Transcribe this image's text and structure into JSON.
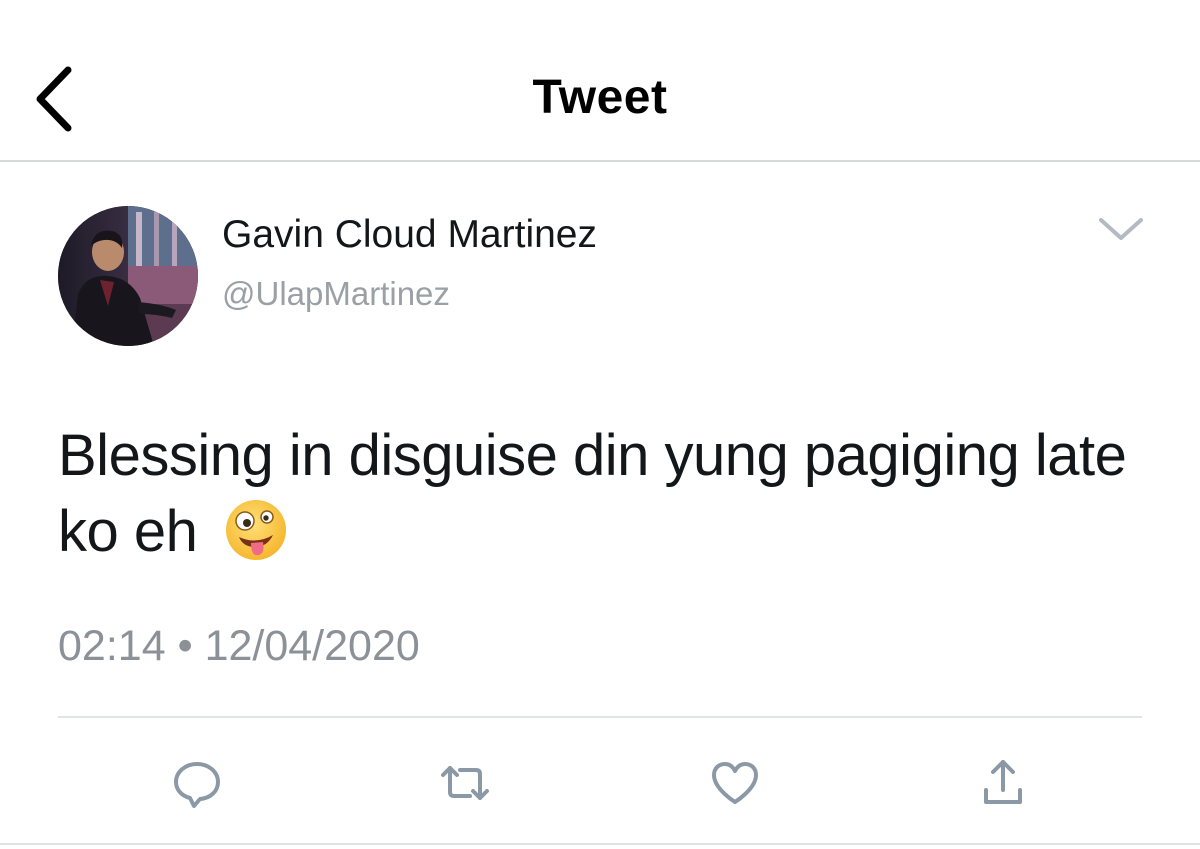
{
  "header": {
    "title": "Tweet",
    "back_icon": "chevron-left-icon"
  },
  "tweet": {
    "author_name": "Gavin Cloud Martinez",
    "author_handle": "@UlapMartinez",
    "text": "Blessing in disguise din yung pagiging late ko eh",
    "emoji": "zany-face-emoji",
    "time": "02:14",
    "separator": "•",
    "date": "12/04/2020"
  },
  "actions": [
    {
      "name": "reply",
      "icon": "reply-icon"
    },
    {
      "name": "retweet",
      "icon": "retweet-icon"
    },
    {
      "name": "like",
      "icon": "heart-icon"
    },
    {
      "name": "share",
      "icon": "share-icon"
    }
  ],
  "colors": {
    "text_primary": "#14171a",
    "text_secondary": "#8b9197",
    "icon_gray": "#8b98a5",
    "divider": "#e1e4e7"
  }
}
